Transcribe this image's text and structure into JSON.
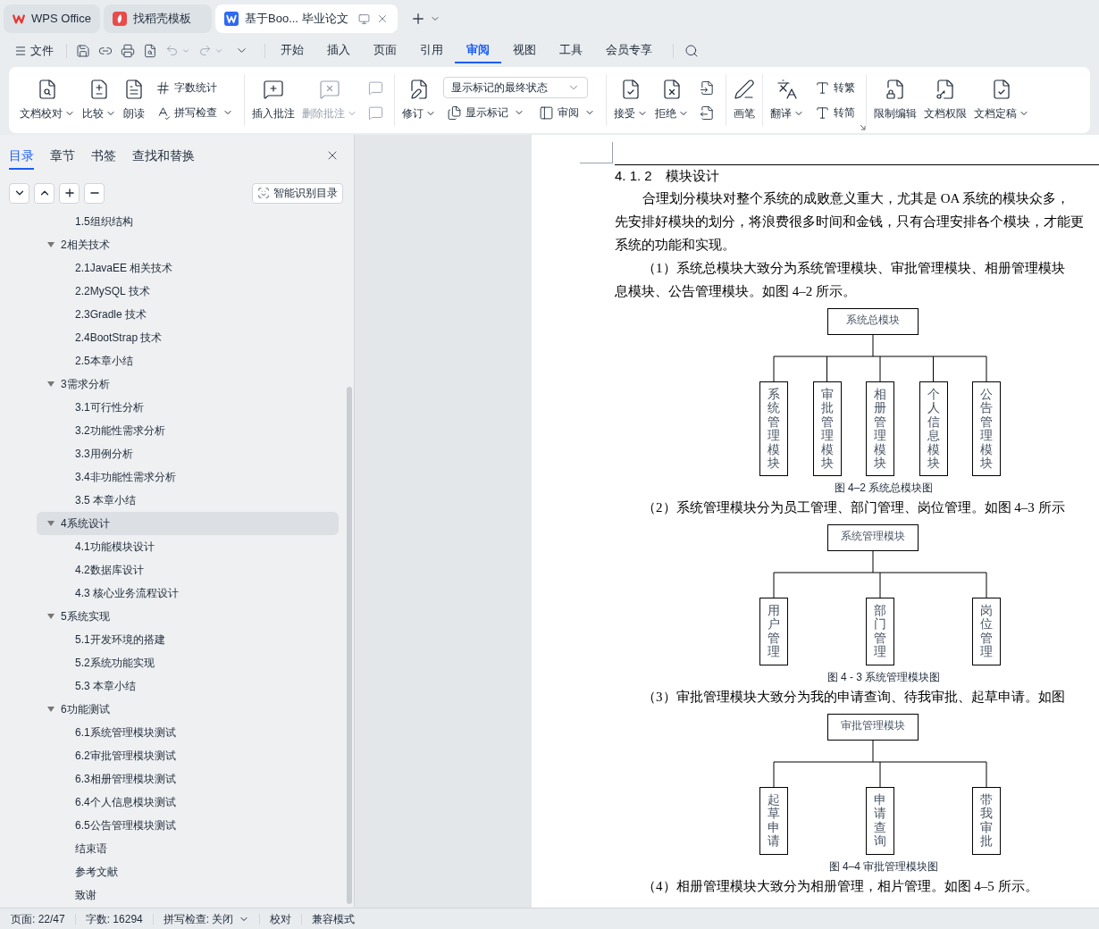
{
  "tabs": [
    {
      "label": "WPS Office",
      "selected": false,
      "kind": "home"
    },
    {
      "label": "找稻壳模板",
      "selected": false,
      "kind": "template"
    },
    {
      "label": "基于Boo... 毕业论文",
      "selected": true,
      "kind": "document"
    }
  ],
  "menu": {
    "file": "文件",
    "tabs": [
      {
        "label": "开始",
        "selected": false
      },
      {
        "label": "插入",
        "selected": false
      },
      {
        "label": "页面",
        "selected": false
      },
      {
        "label": "引用",
        "selected": false
      },
      {
        "label": "审阅",
        "selected": true
      },
      {
        "label": "视图",
        "selected": false
      },
      {
        "label": "工具",
        "selected": false
      },
      {
        "label": "会员专享",
        "selected": false
      }
    ]
  },
  "ribbon": {
    "groups": [
      {
        "launcher": false,
        "items": [
          {
            "kind": "large",
            "label": "文档校对",
            "dropdown": true,
            "disabled": false
          },
          {
            "kind": "large",
            "label": "比较",
            "dropdown": true,
            "disabled": false
          },
          {
            "kind": "large",
            "label": "朗读",
            "dropdown": false,
            "disabled": false
          },
          {
            "kind": "stack",
            "items": [
              {
                "label": "字数统计",
                "dropdown": false,
                "disabled": false
              },
              {
                "label": "拼写检查",
                "dropdown": true,
                "disabled": false
              }
            ]
          }
        ]
      },
      {
        "launcher": false,
        "items": [
          {
            "kind": "large",
            "label": "插入批注",
            "dropdown": false,
            "disabled": false
          },
          {
            "kind": "large",
            "label": "删除批注",
            "dropdown": true,
            "disabled": true
          },
          {
            "kind": "stack",
            "items": [
              {
                "dropdown": false,
                "disabled": true
              },
              {
                "dropdown": false,
                "disabled": true
              }
            ]
          }
        ]
      },
      {
        "launcher": false,
        "items": [
          {
            "kind": "large",
            "label": "修订",
            "dropdown": true,
            "disabled": false
          },
          {
            "kind": "select",
            "value": "显示标记的最终状态",
            "items": [
              {
                "label": "显示标记",
                "dropdown": true,
                "disabled": false
              },
              {
                "label": "审阅",
                "dropdown": true,
                "disabled": false
              }
            ]
          }
        ]
      },
      {
        "launcher": false,
        "items": [
          {
            "kind": "large",
            "label": "接受",
            "dropdown": true,
            "disabled": false
          },
          {
            "kind": "large",
            "label": "拒绝",
            "dropdown": true,
            "disabled": false
          },
          {
            "kind": "stack",
            "items": [
              {
                "dropdown": false,
                "disabled": false
              },
              {
                "dropdown": false,
                "disabled": false
              }
            ]
          }
        ]
      },
      {
        "launcher": false,
        "items": [
          {
            "kind": "large",
            "label": "画笔",
            "dropdown": false,
            "disabled": false
          }
        ]
      },
      {
        "launcher": true,
        "items": [
          {
            "kind": "large",
            "label": "翻译",
            "dropdown": true,
            "disabled": false
          },
          {
            "kind": "stack",
            "items": [
              {
                "label": "转繁",
                "dropdown": false,
                "disabled": false
              },
              {
                "label": "转简",
                "dropdown": false,
                "disabled": false
              }
            ]
          }
        ]
      },
      {
        "launcher": false,
        "items": [
          {
            "kind": "large",
            "label": "限制编辑",
            "dropdown": false,
            "disabled": false
          },
          {
            "kind": "large",
            "label": "文档权限",
            "dropdown": false,
            "disabled": false
          },
          {
            "kind": "large",
            "label": "文档定稿",
            "dropdown": true,
            "disabled": false
          }
        ]
      }
    ]
  },
  "nav": {
    "tabs": [
      {
        "label": "目录",
        "selected": true
      },
      {
        "label": "章节",
        "selected": false
      },
      {
        "label": "书签",
        "selected": false
      },
      {
        "label": "查找和替换",
        "selected": false
      }
    ],
    "smart_button": "智能识别目录",
    "toc": [
      {
        "children": [
          {
            "label": "1.5组织结构",
            "selected": false
          }
        ]
      },
      {
        "label": "2相关技术",
        "expanded": true,
        "selected": false,
        "children": [
          {
            "label": "2.1JavaEE 相关技术",
            "selected": false
          },
          {
            "label": "2.2MySQL 技术",
            "selected": false
          },
          {
            "label": "2.3Gradle 技术",
            "selected": false
          },
          {
            "label": "2.4BootStrap 技术",
            "selected": false
          },
          {
            "label": "2.5本章小结",
            "selected": false
          }
        ]
      },
      {
        "label": "3需求分析",
        "expanded": true,
        "selected": false,
        "children": [
          {
            "label": "3.1可行性分析",
            "selected": false
          },
          {
            "label": "3.2功能性需求分析",
            "selected": false
          },
          {
            "label": "3.3用例分析",
            "selected": false
          },
          {
            "label": "3.4非功能性需求分析",
            "selected": false
          },
          {
            "label": "3.5 本章小结",
            "selected": false
          }
        ]
      },
      {
        "label": "4系统设计",
        "expanded": true,
        "selected": true,
        "children": [
          {
            "label": "4.1功能模块设计",
            "selected": false
          },
          {
            "label": "4.2数据库设计",
            "selected": false
          },
          {
            "label": "4.3 核心业务流程设计",
            "selected": false
          }
        ]
      },
      {
        "label": "5系统实现",
        "expanded": true,
        "selected": false,
        "children": [
          {
            "label": "5.1开发环境的搭建",
            "selected": false
          },
          {
            "label": "5.2系统功能实现",
            "selected": false
          },
          {
            "label": "5.3 本章小结",
            "selected": false
          }
        ]
      },
      {
        "label": "6功能测试",
        "expanded": true,
        "selected": false,
        "children": [
          {
            "label": "6.1系统管理模块测试",
            "selected": false
          },
          {
            "label": "6.2审批管理模块测试",
            "selected": false
          },
          {
            "label": "6.3相册管理模块测试",
            "selected": false
          },
          {
            "label": "6.4个人信息模块测试",
            "selected": false
          },
          {
            "label": "6.5公告管理模块测试",
            "selected": false
          }
        ]
      },
      {
        "children": [
          {
            "label": "结束语",
            "selected": false
          },
          {
            "label": "参考文献",
            "selected": false
          },
          {
            "label": "致谢",
            "selected": false
          }
        ]
      }
    ]
  },
  "document": {
    "heading_number": "4. 1. 2",
    "heading_title": "模块设计",
    "blocks": [
      {
        "kind": "paragraph",
        "lines": [
          "合理划分模块对整个系统的成败意义重大，尤其是 OA 系统的模块众多，",
          "先安排好模块的划分，将浪费很多时间和金钱，只有合理安排各个模块，才能更",
          "系统的功能和实现。"
        ]
      },
      {
        "kind": "paragraph",
        "lines": [
          "（1）系统总模块大致分为系统管理模块、审批管理模块、相册管理模块",
          "息模块、公告管理模块。如图 4–2 所示。"
        ]
      },
      {
        "kind": "diagram",
        "root": "系统总模块",
        "children": [
          "系统管理模块",
          "审批管理模块",
          "相册管理模块",
          "个人信息模块",
          "公告管理模块"
        ],
        "caption": "图 4–2 系统总模块图"
      },
      {
        "kind": "paragraph",
        "lines": [
          "（2）系统管理模块分为员工管理、部门管理、岗位管理。如图 4–3 所示"
        ]
      },
      {
        "kind": "diagram",
        "root": "系统管理模块",
        "children": [
          "用户管理",
          "部门管理",
          "岗位管理"
        ],
        "caption": "图 4 - 3  系统管理模块图"
      },
      {
        "kind": "paragraph",
        "lines": [
          "（3）审批管理模块大致分为我的申请查询、待我审批、起草申请。如图"
        ]
      },
      {
        "kind": "diagram",
        "root": "审批管理模块",
        "children": [
          "起草申请",
          "申请查询",
          "带我审批"
        ],
        "caption": "图 4–4 审批管理模块图"
      },
      {
        "kind": "paragraph",
        "lines": [
          "（4）相册管理模块大致分为相册管理，相片管理。如图 4–5 所示。"
        ]
      }
    ]
  },
  "status_bar": [
    {
      "label": "页面: 22/47",
      "dropdown": false
    },
    {
      "label": "字数: 16294",
      "dropdown": false
    },
    {
      "label": "拼写检查: 关闭",
      "dropdown": true
    },
    {
      "label": "校对",
      "dropdown": false
    },
    {
      "label": "兼容模式",
      "dropdown": false
    }
  ]
}
